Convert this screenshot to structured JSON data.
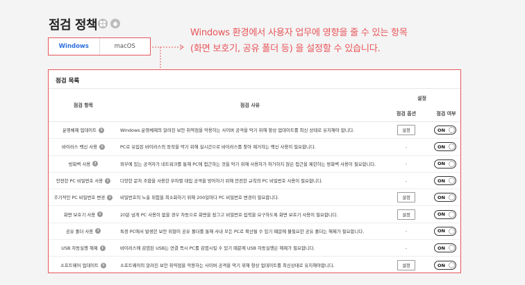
{
  "page": {
    "title": "점검 정책"
  },
  "os_icons": [
    "windows-icon",
    "apple-icon"
  ],
  "tabs": [
    {
      "label": "Windows",
      "active": true
    },
    {
      "label": "macOS",
      "active": false
    }
  ],
  "callout": {
    "line1": "Windows 환경에서 사용자 업무에 영향을 줄 수 있는 항목",
    "line2": "(화면 보호기, 공유 폴더 등) 을 설정할 수 있습니다."
  },
  "panel": {
    "title": "점검 목록",
    "headers": {
      "item": "점검 항목",
      "reason": "점검 사유",
      "setting": "설정",
      "option": "점검 옵션",
      "use": "점검 여부"
    },
    "rows": [
      {
        "name": "운영체제 업데이트",
        "reason": "Windows 운영체제의 알려진 보안 취약점을 악용하는 사이버 공격을 막기 위해 항상 업데이트를 최신 상태로 유지해야 합니다.",
        "option": "설정",
        "toggle": "ON"
      },
      {
        "name": "바이러스 백신 사용",
        "reason": "PC로 유입된 바이러스의 동작을 막기 위해 실시간으로 바이러스를 찾아 제거하는 백신 사용이 필요합니다.",
        "option": "-",
        "toggle": "ON"
      },
      {
        "name": "방화벽 사용",
        "reason": "외부에 있는 공격자가 네트워크를 통해 PC에 접근하는 것을 막기 위해 사용자가 허가하지 않은 접근을 제한하는 방화벽 사용이 필요합니다.",
        "option": "-",
        "toggle": "ON"
      },
      {
        "name": "안전한 PC 비밀번호 사용",
        "reason": "다양한 문자 조합을 사용한 무차별 대입 공격을 방어하기 위해 안전한 규칙의 PC 비밀번호 사용이 필요합니다.",
        "option": "-",
        "toggle": "ON"
      },
      {
        "name": "주기적인 PC 비밀번호 변경",
        "reason": "비밀번호의 노출 위험을 최소화하기 위해 200일마다 PC 비밀번호 변경이 필요합니다.",
        "option": "설정",
        "toggle": "ON"
      },
      {
        "name": "화면 보호기 사용",
        "reason": "20분 넘게 PC 사용이 없을 경우 자동으로 화면을 잠그고 비밀번호 입력을 요구하도록 화면 보호기 사용이 필요합니다.",
        "option": "설정",
        "toggle": "ON"
      },
      {
        "name": "공유 폴더 사용",
        "reason": "특정 PC에서 발생한 보안 위협이 공유 폴더를 통해 사내 모든 PC로 확산될 수 있기 때문에 불필요한 공유 폴더는 해제가 필요합니다.",
        "option": "-",
        "toggle": "ON"
      },
      {
        "name": "USB 자동실행 해제",
        "reason": "바이러스에 감염된 USB는 연결 즉시 PC를 감염시킬 수 있기 때문에 USB 자동실행은 해제가 필요합니다.",
        "option": "-",
        "toggle": "ON"
      },
      {
        "name": "소프트웨어 업데이트",
        "reason": "소프트웨어의 알려진 보안 취약점을 악용하는 사이버 공격을 막기 위해 항상 업데이트를 최신상태로 유지해야합니다.",
        "option": "설정",
        "toggle": "ON"
      }
    ]
  },
  "colors": {
    "accent": "#e8555a",
    "tab_active": "#2d6fdb"
  }
}
